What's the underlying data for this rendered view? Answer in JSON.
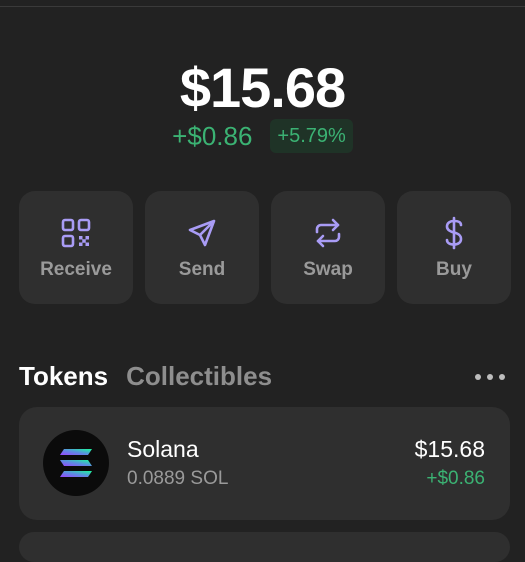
{
  "balance": {
    "total": "$15.68",
    "change_amount": "+$0.86",
    "change_percent": "+5.79%"
  },
  "actions": [
    {
      "label": "Receive",
      "icon": "qr-code-icon"
    },
    {
      "label": "Send",
      "icon": "send-arrow-icon"
    },
    {
      "label": "Swap",
      "icon": "swap-arrows-icon"
    },
    {
      "label": "Buy",
      "icon": "dollar-icon"
    }
  ],
  "tabs": {
    "tokens": "Tokens",
    "collectibles": "Collectibles"
  },
  "tokens": [
    {
      "name": "Solana",
      "amount": "0.0889 SOL",
      "value": "$15.68",
      "change": "+$0.86",
      "icon": "solana-logo-icon"
    }
  ],
  "colors": {
    "background": "#222222",
    "card": "#2f2f2f",
    "positive": "#3bb273",
    "accent_icon": "#a99cf5"
  }
}
